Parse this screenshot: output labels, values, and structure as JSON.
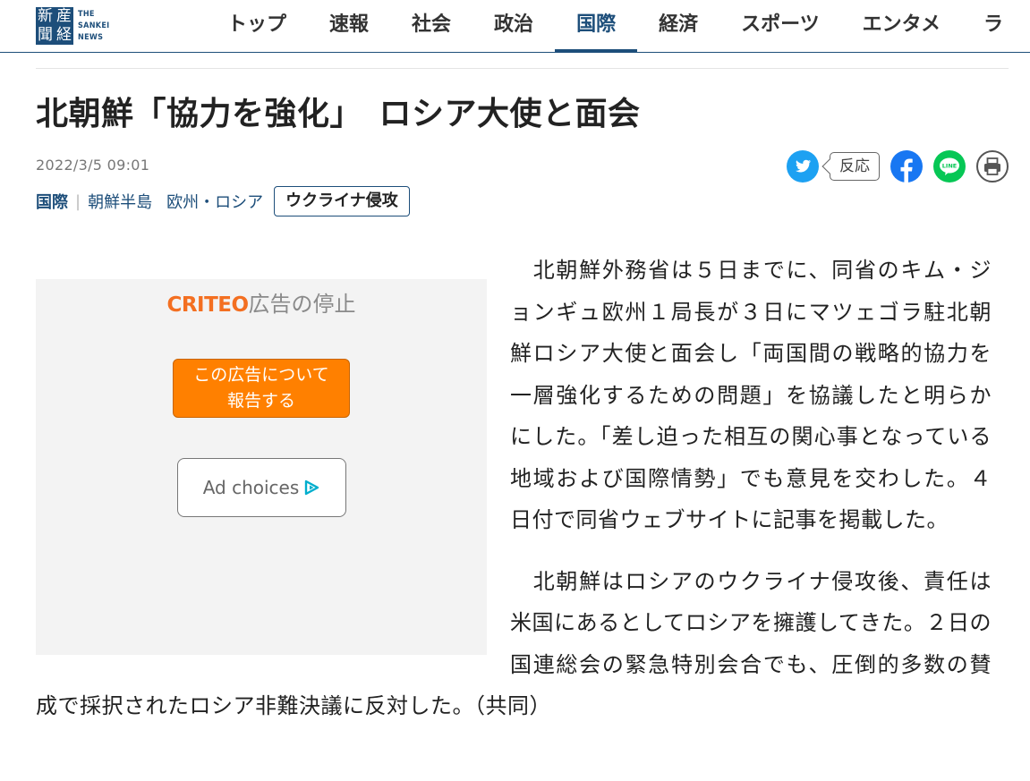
{
  "header": {
    "logo_mark": [
      "新",
      "産",
      "聞",
      "経"
    ],
    "logo_text": [
      "THE",
      "SANKEI",
      "NEWS"
    ],
    "nav": [
      {
        "label": "トップ",
        "active": false
      },
      {
        "label": "速報",
        "active": false
      },
      {
        "label": "社会",
        "active": false
      },
      {
        "label": "政治",
        "active": false
      },
      {
        "label": "国際",
        "active": true
      },
      {
        "label": "経済",
        "active": false
      },
      {
        "label": "スポーツ",
        "active": false
      },
      {
        "label": "エンタメ",
        "active": false
      },
      {
        "label": "ラ",
        "active": false
      }
    ]
  },
  "article": {
    "title": "北朝鮮「協力を強化」　ロシア大使と面会",
    "date": "2022/3/5 09:01",
    "category": "国際",
    "tags": [
      "朝鮮半島",
      "欧州・ロシア"
    ],
    "featured_tag": "ウクライナ侵攻",
    "paragraphs": [
      "　北朝鮮外務省は５日までに、同省のキム・ジョンギュ欧州１局長が３日にマツェゴラ駐北朝鮮ロシア大使と面会し「両国間の戦略的協力を一層強化するための問題」を協議したと明らかにした。「差し迫った相互の関心事となっている地域および国際情勢」でも意見を交わした。４日付で同省ウェブサイトに記事を掲載した。",
      "　北朝鮮はロシアのウクライナ侵攻後、責任は米国にあるとしてロシアを擁護してきた。２日の国連総会の緊急特別会合でも、圧倒的多数の賛成で採択されたロシア非難決議に反対した。（共同）"
    ]
  },
  "share": {
    "reaction_label": "反応",
    "icons": [
      "twitter-icon",
      "facebook-icon",
      "line-icon",
      "print-icon"
    ],
    "line_label": "LINE",
    "colors": {
      "twitter": "#1da1f2",
      "facebook": "#1877f2",
      "line": "#06c755",
      "print": "#555555"
    }
  },
  "ad": {
    "brand": "CRITEO",
    "stop_label": "広告の停止",
    "report_button": [
      "この広告について",
      "報告する"
    ],
    "choices_label": "Ad choices"
  },
  "colors": {
    "brand": "#1d4e7a",
    "ad_button": "#ff8000",
    "criteo": "#f36f21"
  }
}
